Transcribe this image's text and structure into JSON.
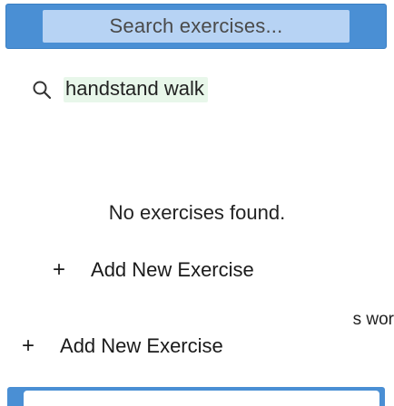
{
  "search": {
    "button_label": "Search exercises...",
    "query": "handstand walk",
    "icon": "search-icon"
  },
  "results": {
    "empty_message": "No exercises found."
  },
  "actions": {
    "add_exercise_label": "Add New Exercise",
    "add_exercise_icon": "+",
    "add_exercise_label_2": "Add New Exercise",
    "add_exercise_icon_2": "+"
  },
  "background": {
    "clipped_text": "s wor"
  },
  "colors": {
    "accent": "#4a8fd4",
    "search_inner": "#b7d3f4",
    "query_highlight": "#e8f7ea"
  }
}
